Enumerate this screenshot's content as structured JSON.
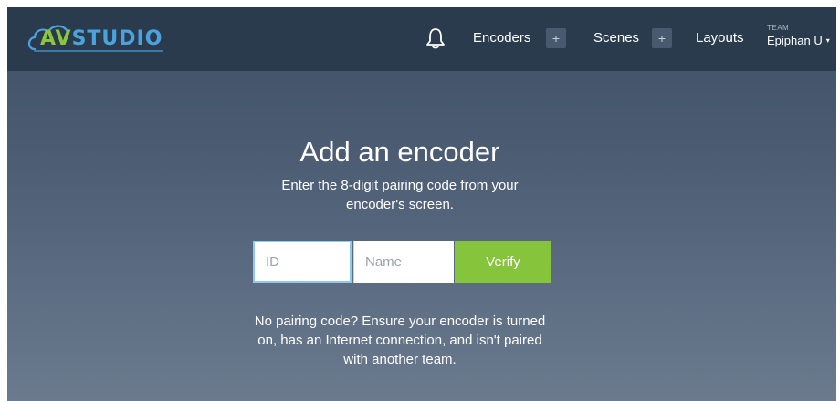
{
  "brand": {
    "name_prefix": "AV",
    "name_suffix": "STUDIO",
    "colors": {
      "av": "#8cc63f",
      "studio": "#4aa3df"
    }
  },
  "navbar": {
    "notifications_icon": "bell-icon",
    "items": [
      {
        "label": "Encoders",
        "add_label": "+"
      },
      {
        "label": "Scenes",
        "add_label": "+"
      },
      {
        "label": "Layouts"
      }
    ],
    "team": {
      "label": "TEAM",
      "name": "Epiphan U",
      "caret": "▾"
    }
  },
  "main": {
    "title": "Add an encoder",
    "instructions": "Enter the 8-digit pairing code from your encoder's screen.",
    "form": {
      "id_placeholder": "ID",
      "id_value": "",
      "name_placeholder": "Name",
      "name_value": "",
      "verify_label": "Verify"
    },
    "help": "No pairing code? Ensure your encoder is turned on, has an Internet connection, and isn't paired with another team."
  },
  "colors": {
    "navbar_bg": "#2b3b4e",
    "verify_button": "#85c43b",
    "focus_border": "#8ec9ee"
  }
}
